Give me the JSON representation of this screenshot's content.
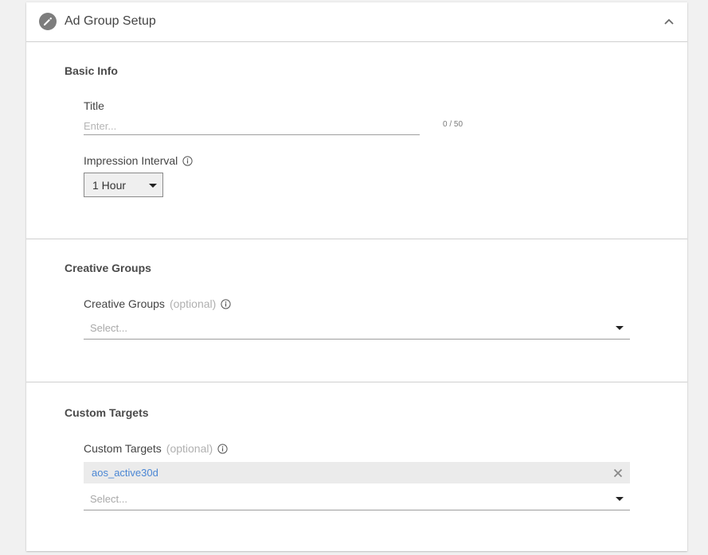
{
  "panel": {
    "title": "Ad Group Setup",
    "edit_icon": "pencil-icon",
    "collapse_icon": "chevron-up-icon"
  },
  "basic_info": {
    "section_title": "Basic Info",
    "title_field": {
      "label": "Title",
      "value": "",
      "placeholder": "Enter...",
      "counter": "0 / 50"
    },
    "impression_interval": {
      "label": "Impression Interval",
      "info_icon": "info-icon",
      "selected": "1 Hour"
    }
  },
  "creative_groups": {
    "section_title": "Creative Groups",
    "field": {
      "label": "Creative Groups",
      "optional": "(optional)",
      "info_icon": "info-icon",
      "placeholder": "Select..."
    }
  },
  "custom_targets": {
    "section_title": "Custom Targets",
    "field": {
      "label": "Custom Targets",
      "optional": "(optional)",
      "info_icon": "info-icon",
      "selected_chips": [
        {
          "label": "aos_active30d"
        }
      ],
      "placeholder": "Select..."
    }
  },
  "colors": {
    "chip_text": "#4a86d4",
    "divider": "#cfcfcf",
    "background": "#f1f1f1"
  }
}
